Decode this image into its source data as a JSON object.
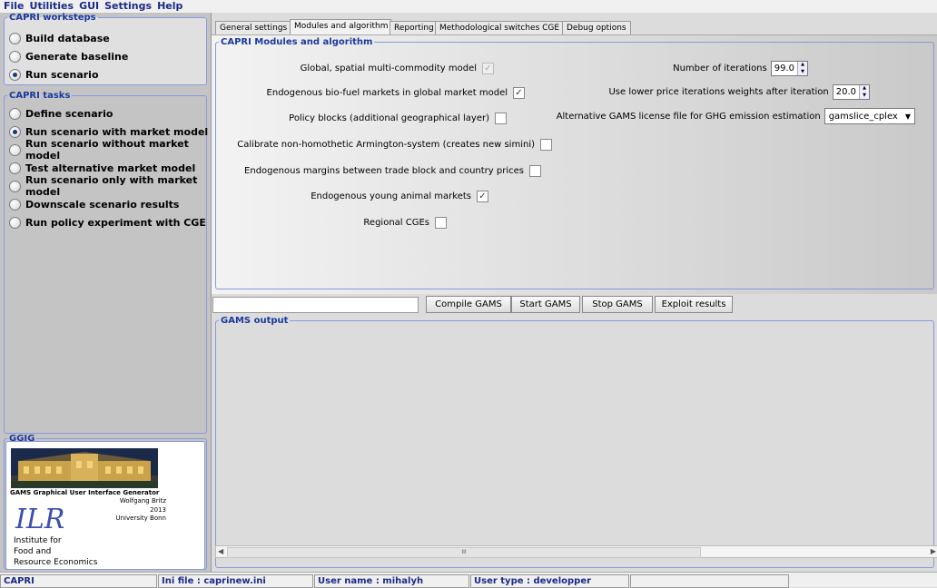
{
  "menu": [
    "File",
    "Utilities",
    "GUI",
    "Settings",
    "Help"
  ],
  "worksteps": {
    "legend": "CAPRI worksteps",
    "items": [
      {
        "label": "Build database",
        "selected": false
      },
      {
        "label": "Generate baseline",
        "selected": false
      },
      {
        "label": "Run scenario",
        "selected": true
      }
    ]
  },
  "tasks": {
    "legend": "CAPRI tasks",
    "items": [
      {
        "label": "Define scenario",
        "selected": false
      },
      {
        "label": "Run scenario with market model",
        "selected": true
      },
      {
        "label": "Run scenario without market model",
        "selected": false
      },
      {
        "label": "Test alternative market model",
        "selected": false
      },
      {
        "label": "Run scenario only with market model",
        "selected": false
      },
      {
        "label": "Downscale scenario results",
        "selected": false
      },
      {
        "label": "Run policy experiment with CGE",
        "selected": false
      }
    ]
  },
  "ggig": {
    "legend": "GGIG",
    "title": "GAMS Graphical User Interface Generator",
    "author": "Wolfgang Britz",
    "year": "2013",
    "university": "University Bonn",
    "logo_text": "ILR",
    "institute_lines": [
      "Institute  for",
      "Food and",
      "Resource Economics"
    ]
  },
  "tabs": [
    {
      "label": "General settings",
      "active": false
    },
    {
      "label": "Modules and algorithm",
      "active": true
    },
    {
      "label": "Reporting",
      "active": false
    },
    {
      "label": "Methodological switches CGE",
      "active": false
    },
    {
      "label": "Debug options",
      "active": false
    }
  ],
  "modules": {
    "legend": "CAPRI Modules and algorithm",
    "checks": [
      {
        "label": "Global, spatial multi-commodity model",
        "checked": true,
        "disabled": true
      },
      {
        "label": "Endogenous bio-fuel markets in global market model",
        "checked": true,
        "disabled": false
      },
      {
        "label": "Policy blocks (additional geographical layer)",
        "checked": false,
        "disabled": false
      },
      {
        "label": "Calibrate non-homothetic Armington-system (creates new simini)",
        "checked": false,
        "disabled": false
      },
      {
        "label": "Endogenous margins between trade block and country prices",
        "checked": false,
        "disabled": false
      },
      {
        "label": "Endogenous young animal markets",
        "checked": true,
        "disabled": false
      },
      {
        "label": "Regional CGEs",
        "checked": false,
        "disabled": false
      }
    ],
    "iterations_label": "Number of iterations",
    "iterations_value": "99.0",
    "lower_price_label": "Use lower price iterations weights after iteration",
    "lower_price_value": "20.0",
    "license_label": "Alternative GAMS license file for GHG emission estimation",
    "license_value": "gamslice_cplex"
  },
  "buttons": {
    "compile": "Compile GAMS",
    "start": "Start GAMS",
    "stop": "Stop GAMS",
    "exploit": "Exploit results"
  },
  "output": {
    "legend": "GAMS output",
    "scroll_mark": "III"
  },
  "status": {
    "app": "CAPRI",
    "ini": "Ini file : caprinew.ini",
    "user": "User name : mihalyh",
    "type": "User type : developper"
  }
}
